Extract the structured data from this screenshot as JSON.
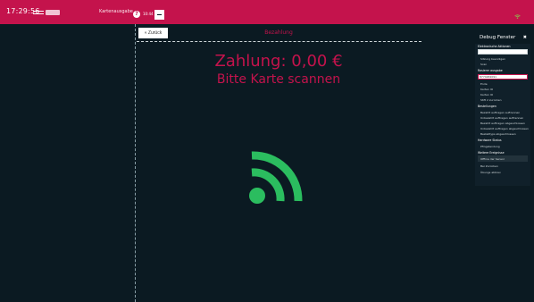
{
  "topbar": {
    "time": "17:29:56",
    "section_label": "Kartenausgabe",
    "user_label": "10:44",
    "help_glyph": "?"
  },
  "content": {
    "back_label": "« Zurück",
    "page_title": "Bezahlung",
    "amount_text": "Zahlung: 0,00 €",
    "scan_text": "Bitte Karte scannen"
  },
  "debug": {
    "title": "Debug Fenster",
    "close_glyph": "✖",
    "section1": "Elektronische Aktionen",
    "item1": "Sitzung beendigen",
    "item2": "Scan",
    "section2": "Rasierer ausgabe",
    "input_value": "8774482091",
    "items2": [
      "Ende",
      "Karten IO",
      "Karten IO",
      "Stift 2 zurücken"
    ],
    "section3": "Bestellungen",
    "items3": [
      "Bezahlt auftragen auftrennen",
      "Unbezahlt auftragen auftrennen",
      "Bezahlt auftragen abgeschlossen",
      "Unbezahlt auftragen abgeschlossen",
      "Bestelltyps abgeschlossen"
    ],
    "section4": "Hardware Status",
    "items4": [
      "Pfingstendung"
    ],
    "section5": "Weitere Ereignisse",
    "items5": [
      "Offline der Sensor",
      "Bei Zurücken",
      "Übungs abbrev"
    ]
  },
  "colors": {
    "brand": "#c4134c",
    "background": "#0b1a22",
    "nfc_green": "#2bbd5f"
  },
  "icons": {
    "nfc": "nfc-icon",
    "wifi": "wifi-icon",
    "help": "help-icon",
    "minus": "minus-icon"
  }
}
